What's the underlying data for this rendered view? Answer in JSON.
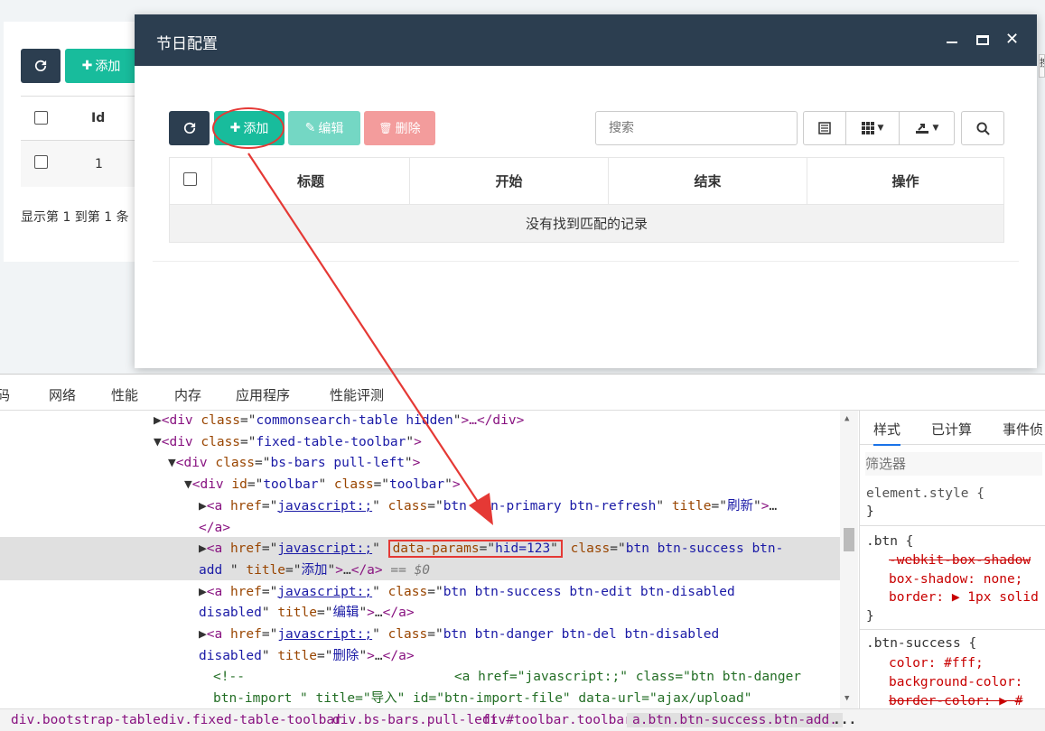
{
  "background": {
    "add_label": "添加",
    "col_id": "Id",
    "row_id": "1",
    "footer": "显示第 1 到第 1 条"
  },
  "modal": {
    "title": "节日配置",
    "toolbar": {
      "add": "添加",
      "edit": "编辑",
      "delete": "删除",
      "search_placeholder": "搜索"
    },
    "table": {
      "headers": [
        "标题",
        "开始",
        "结束",
        "操作"
      ],
      "empty": "没有找到匹配的记录"
    }
  },
  "devtools": {
    "tabs": [
      "码",
      "网络",
      "性能",
      "内存",
      "应用程序",
      "性能评测"
    ],
    "styles_tabs": [
      "样式",
      "已计算",
      "事件侦"
    ],
    "filter_placeholder": "筛选器",
    "styles": {
      "element_style": "element.style {",
      "close": "}",
      "btn_rule": ".btn {",
      "btn_prop1": "-webkit-box-shadow",
      "btn_prop2": "box-shadow: none;",
      "btn_prop3": "border: ▶ 1px solid",
      "success_rule": ".btn-success {",
      "success_prop1": "color: #fff;",
      "success_prop2": "background-color:",
      "success_prop3": "border-color: ▶ #"
    },
    "breadcrumbs": [
      "div.bootstrap-table",
      "div.fixed-table-toolbar",
      "div.bs-bars.pull-left",
      "div#toolbar.toolbar",
      "a.btn.btn-success.btn-add.",
      "..."
    ],
    "code": {
      "l1_tag": "div",
      "l1_attr": "class",
      "l1_val": "commonsearch-table hidden",
      "l1_rest": "…</div>",
      "l2_val": "fixed-table-toolbar",
      "l3_val": "bs-bars pull-left",
      "l4_id": "toolbar",
      "l4_class": "toolbar",
      "href": "javascript:;",
      "l5_class": "btn btn-primary btn-refresh",
      "l5_title": "刷新",
      "l5_end": "</a>",
      "l6_params": "hid=123",
      "l6_class": "btn btn-success btn-",
      "l6_class2": "add ",
      "l6_title": "添加",
      "l6_eq": "== $0",
      "l7_class": "btn btn-success btn-edit btn-disabled",
      "l7_class2": "disabled",
      "l7_title": "编辑",
      "l8_class": "btn btn-danger btn-del btn-disabled",
      "l8_class2": "disabled",
      "l8_title": "删除",
      "l9_comment": "<!--",
      "l9_rest": "<a href=\"javascript:;\" class=\"btn btn-danger",
      "l10": "btn-import \" title=\"导入\" id=\"btn-import-file\" data-url=\"ajax/upload\""
    }
  },
  "colors": {
    "dark": "#2c3e50",
    "success": "#18bc9c",
    "danger": "#f39c9c",
    "annotation": "#e53935"
  }
}
